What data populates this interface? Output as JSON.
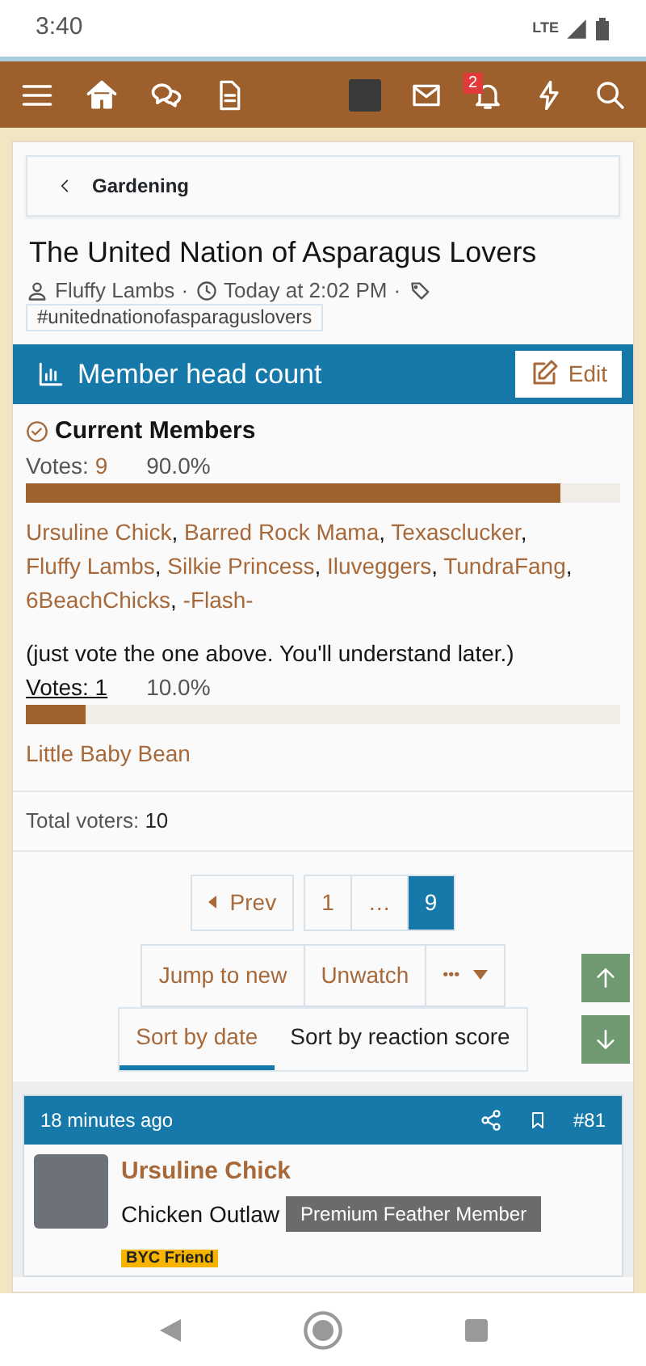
{
  "status_bar": {
    "time": "3:40",
    "network": "LTE"
  },
  "header": {
    "notification_count": "2"
  },
  "breadcrumb": {
    "label": "Gardening"
  },
  "thread": {
    "title": "The United Nation of Asparagus Lovers",
    "author": "Fluffy Lambs",
    "separator": "·",
    "date": "Today at 2:02 PM",
    "tags": [
      "#unitednationofasparaguslovers"
    ]
  },
  "poll": {
    "title": "Member head count",
    "edit_label": "Edit",
    "voter_separator": ",",
    "options": [
      {
        "label": "Current Members",
        "selected": true,
        "votes_label": "Votes:",
        "votes": "9",
        "percent": "90.0%",
        "level": 0.9,
        "voters": [
          "Ursuline Chick",
          "Barred Rock Mama",
          "Texasclucker",
          "Fluffy Lambs",
          "Silkie Princess",
          "Iluveggers",
          "TundraFang",
          "6BeachChicks",
          "-Flash-"
        ]
      },
      {
        "label": "(just vote the one above. You'll understand later.)",
        "selected": false,
        "votes_label": "Votes:",
        "votes": "1",
        "percent": "10.0%",
        "level": 0.1,
        "voters": [
          "Little Baby Bean"
        ]
      }
    ],
    "total_label": "Total voters:",
    "total": "10"
  },
  "pagination": {
    "prev": "Prev",
    "pages": [
      {
        "label": "1",
        "selected": false
      },
      {
        "label": "…",
        "selected": false
      },
      {
        "label": "9",
        "selected": true
      }
    ]
  },
  "actions": [
    "Jump to new",
    "Unwatch",
    "•••"
  ],
  "sort_tabs": [
    {
      "label": "Sort by date",
      "selected": true
    },
    {
      "label": "Sort by reaction score",
      "selected": false
    }
  ],
  "post": {
    "time": "18 minutes ago",
    "number": "#81",
    "author": "Ursuline Chick",
    "user_title": "Chicken Outlaw",
    "banner": "Premium Feather Member",
    "badge": "BYC Friend"
  }
}
